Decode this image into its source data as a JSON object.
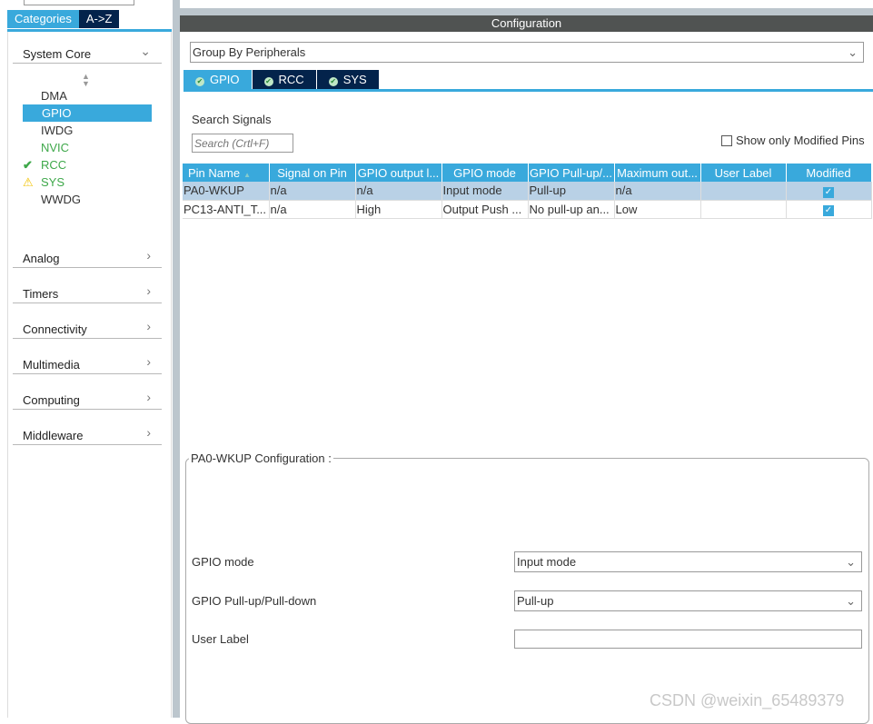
{
  "left": {
    "tabs": [
      {
        "label": "Categories",
        "active": true
      },
      {
        "label": "A->Z",
        "active": false
      }
    ],
    "categories": [
      {
        "label": "System Core",
        "expanded": true,
        "icon": "chevron-down-icon"
      },
      {
        "label": "Analog",
        "icon": "chevron-right-icon"
      },
      {
        "label": "Timers",
        "icon": "chevron-right-icon"
      },
      {
        "label": "Connectivity",
        "icon": "chevron-right-icon"
      },
      {
        "label": "Multimedia",
        "icon": "chevron-right-icon"
      },
      {
        "label": "Computing",
        "icon": "chevron-right-icon"
      },
      {
        "label": "Middleware",
        "icon": "chevron-right-icon"
      }
    ],
    "system_core_items": [
      {
        "label": "DMA"
      },
      {
        "label": "GPIO",
        "selected": true
      },
      {
        "label": "IWDG"
      },
      {
        "label": "NVIC",
        "status": "green"
      },
      {
        "label": "RCC",
        "status": "check-icon"
      },
      {
        "label": "SYS",
        "status": "warning-icon"
      },
      {
        "label": "WWDG"
      }
    ]
  },
  "config": {
    "title": "Configuration",
    "group_by": "Group By Peripherals",
    "tabs": [
      {
        "label": "GPIO",
        "active": true
      },
      {
        "label": "RCC"
      },
      {
        "label": "SYS"
      }
    ],
    "search_label": "Search Signals",
    "search_placeholder": "Search (Crtl+F)",
    "show_modified_label": "Show only Modified Pins",
    "show_modified_checked": false,
    "columns": [
      "Pin Name",
      "Signal on Pin",
      "GPIO output l...",
      "GPIO mode",
      "GPIO Pull-up/...",
      "Maximum out...",
      "User Label",
      "Modified"
    ],
    "rows": [
      {
        "cells": [
          "PA0-WKUP",
          "n/a",
          "n/a",
          "Input mode",
          "Pull-up",
          "n/a",
          ""
        ],
        "modified": true,
        "selected": true
      },
      {
        "cells": [
          "PC13-ANTI_T...",
          "n/a",
          "High",
          "Output Push ...",
          "No pull-up an...",
          "Low",
          ""
        ],
        "modified": true,
        "selected": false
      }
    ],
    "pin_config": {
      "title": "PA0-WKUP Configuration :",
      "gpio_mode_label": "GPIO mode",
      "gpio_mode_value": "Input mode",
      "pull_label": "GPIO Pull-up/Pull-down",
      "pull_value": "Pull-up",
      "user_label_label": "User Label",
      "user_label_value": ""
    }
  },
  "watermark": "CSDN @weixin_65489379",
  "colors": {
    "accent": "#39a9dc",
    "dark_tab": "#03234b",
    "header": "#505352",
    "selected_row": "#b9d1e6",
    "green": "#3ea84a"
  }
}
